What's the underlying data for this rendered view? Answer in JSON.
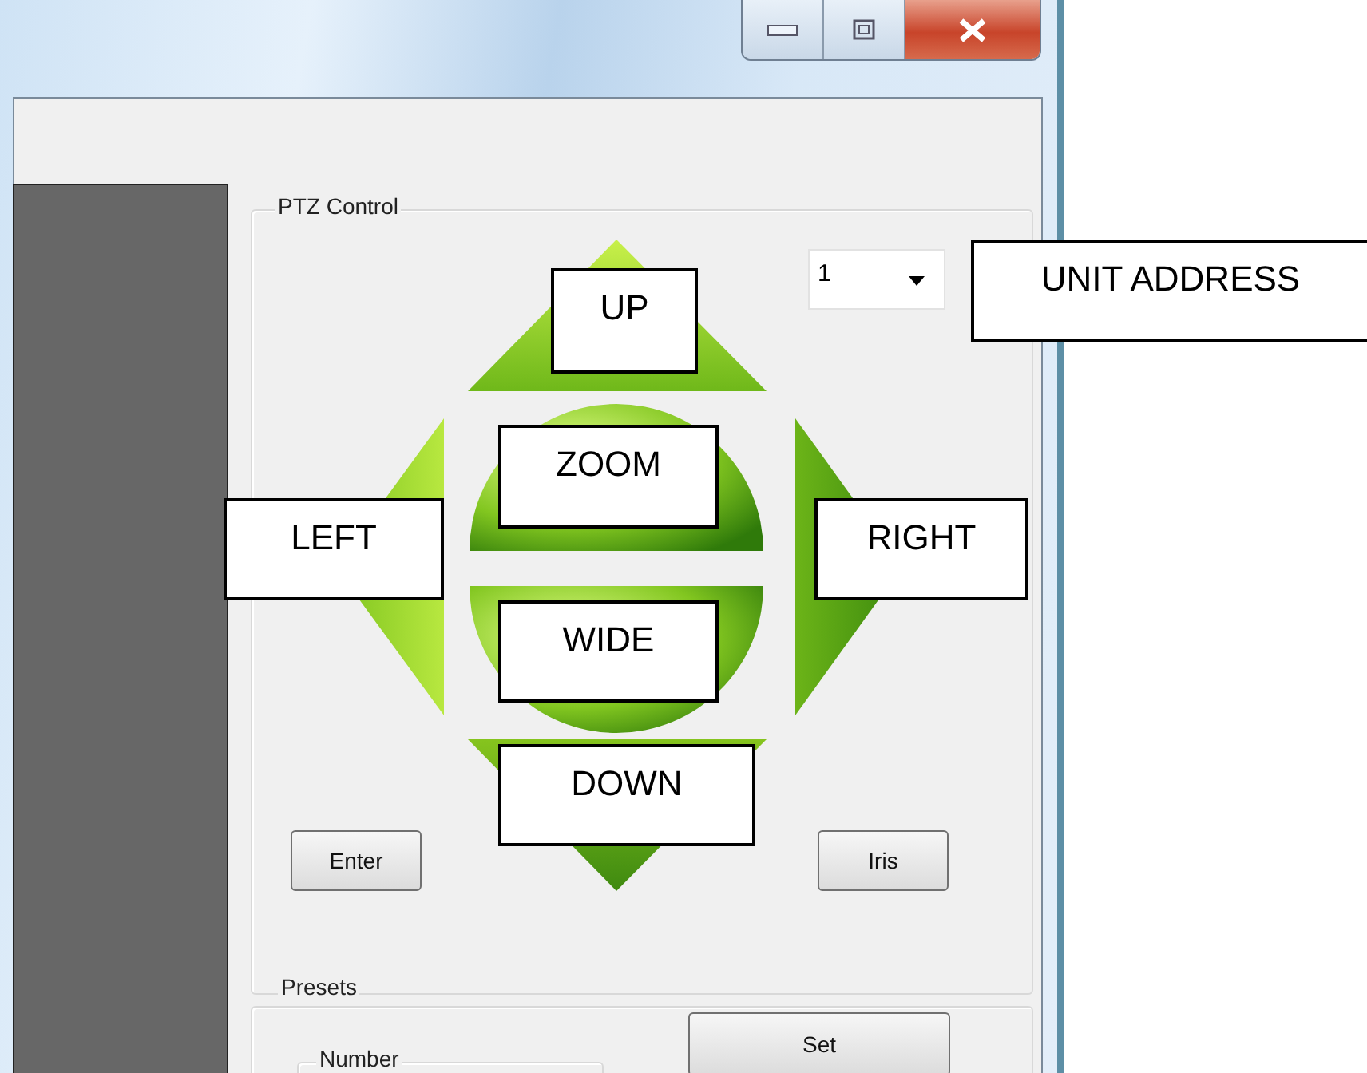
{
  "ptz_control": {
    "title": "PTZ Control",
    "unit_address": {
      "value": "1"
    },
    "buttons": [
      "Enter",
      "Iris"
    ]
  },
  "presets": {
    "title": "Presets",
    "number_label": "Number",
    "button": "Set"
  },
  "callouts": [
    {
      "kind": "up",
      "text": "UP"
    },
    {
      "kind": "unit",
      "text": "UNIT ADDRESS"
    },
    {
      "kind": "zoom",
      "text": "ZOOM"
    },
    {
      "kind": "left",
      "text": "LEFT"
    },
    {
      "kind": "right",
      "text": "RIGHT"
    },
    {
      "kind": "wide",
      "text": "WIDE"
    },
    {
      "kind": "down",
      "text": "DOWN"
    }
  ]
}
